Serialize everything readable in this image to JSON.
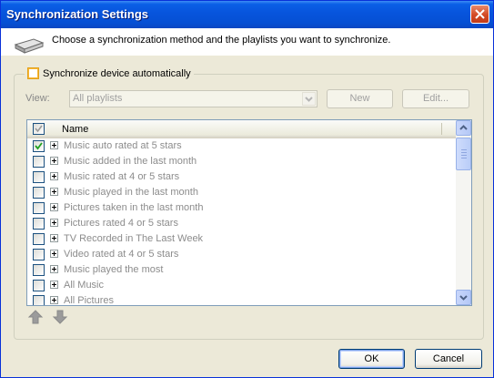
{
  "window": {
    "title": "Synchronization Settings"
  },
  "header": {
    "instruction": "Choose a synchronization method and the playlists you want to synchronize."
  },
  "sync_auto": {
    "label": "Synchronize device automatically",
    "checked": false
  },
  "view": {
    "label": "View:",
    "selected": "All playlists"
  },
  "buttons": {
    "new": "New",
    "edit": "Edit...",
    "ok": "OK",
    "cancel": "Cancel"
  },
  "list": {
    "header_name": "Name",
    "rows": [
      {
        "label": "Music auto rated at 5 stars",
        "checked": true
      },
      {
        "label": "Music added in the last month",
        "checked": false
      },
      {
        "label": "Music rated at 4 or 5 stars",
        "checked": false
      },
      {
        "label": "Music played in the last month",
        "checked": false
      },
      {
        "label": "Pictures taken in the last month",
        "checked": false
      },
      {
        "label": "Pictures rated 4 or 5 stars",
        "checked": false
      },
      {
        "label": "TV Recorded in The Last Week",
        "checked": false
      },
      {
        "label": "Video rated at 4 or 5 stars",
        "checked": false
      },
      {
        "label": "Music played the most",
        "checked": false
      },
      {
        "label": "All Music",
        "checked": false
      },
      {
        "label": "All Pictures",
        "checked": false
      }
    ]
  },
  "colors": {
    "title_bar": "#0754dc",
    "check_green": "#21a121"
  }
}
